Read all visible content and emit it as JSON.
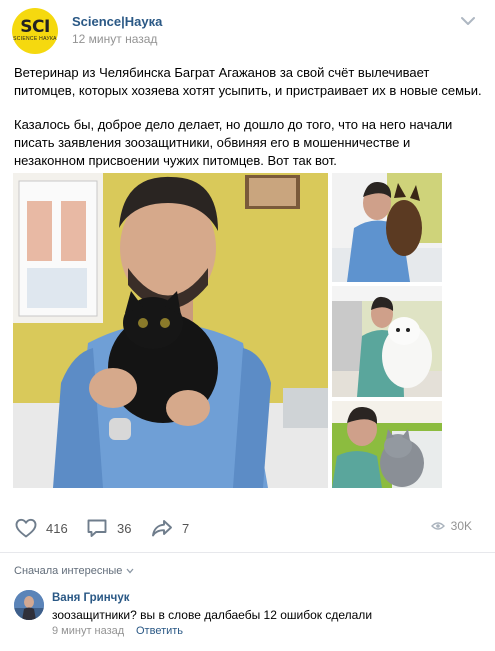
{
  "header": {
    "avatar_text": "SCI",
    "avatar_subtext": "SCIENCE НАУКА",
    "group_name": "Science|Наука",
    "post_time": "12 минут назад"
  },
  "post": {
    "paragraph1": "Ветеринар из Челябинска Баграт Агажанов за свой счёт вылечивает питомцев, которых хозяева хотят усыпить, и пристраивает их в новые семьи.",
    "paragraph2": "Казалось бы, доброе дело делает, но дошло до того, что на него начали писать заявления зоозащитники, обвиняя его в мошенничестве и незаконном присвоении чужих питомцев. Вот так вот."
  },
  "actions": {
    "likes": "416",
    "comments": "36",
    "shares": "7",
    "views": "30K"
  },
  "comments_sort_label": "Сначала интересные",
  "comment": {
    "author": "Ваня Гринчук",
    "text": "зоозащитники? вы в слове далбаебы 12 ошибок сделали",
    "time": "9 минут назад",
    "reply_label": "Ответить"
  },
  "colors": {
    "link": "#2a5885",
    "muted": "#939393",
    "avatar_yellow": "#f5d90f"
  },
  "icons": [
    "chevron-down-icon",
    "heart-icon",
    "comment-icon",
    "share-icon",
    "eye-icon"
  ]
}
